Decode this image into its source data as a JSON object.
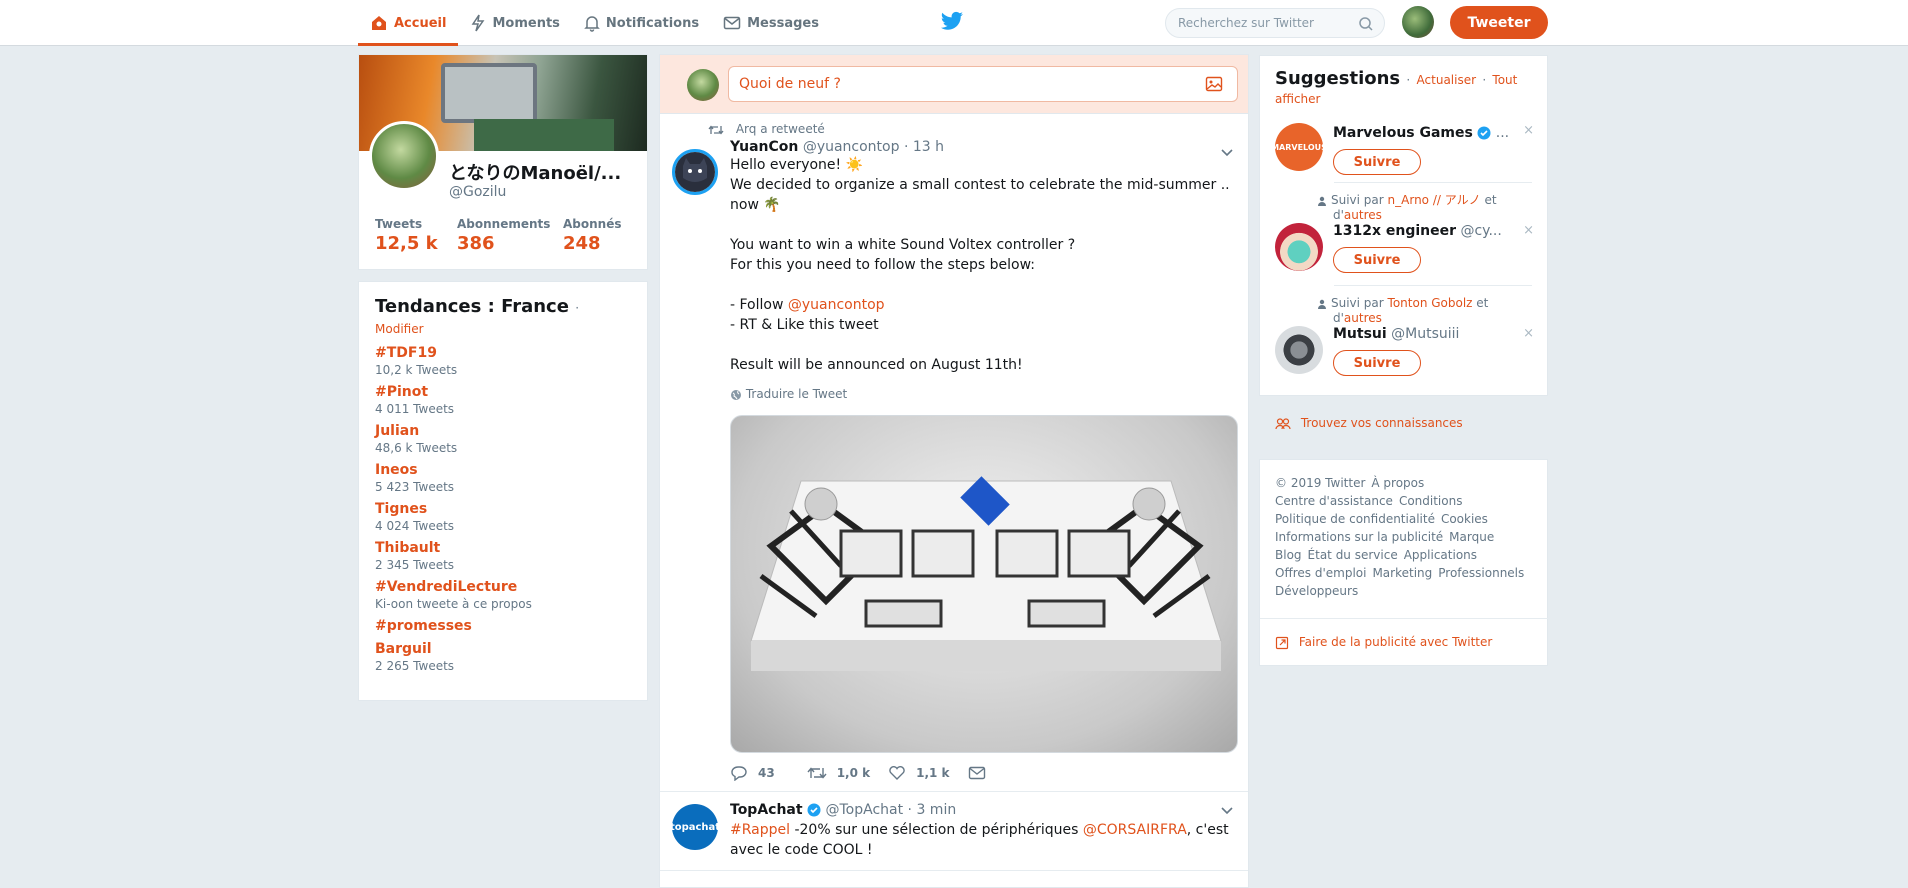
{
  "nav": {
    "home": "Accueil",
    "moments": "Moments",
    "notifications": "Notifications",
    "messages": "Messages",
    "search_placeholder": "Recherchez sur Twitter",
    "tweet_button": "Tweeter"
  },
  "profile": {
    "name": "となりのManoël/...",
    "handle": "@Gozilu",
    "stats": [
      {
        "label": "Tweets",
        "value": "12,5 k"
      },
      {
        "label": "Abonnements",
        "value": "386"
      },
      {
        "label": "Abonnés",
        "value": "248"
      }
    ]
  },
  "trends": {
    "title": "Tendances : France",
    "separator": "·",
    "change": "Modifier",
    "items": [
      {
        "name": "#TDF19",
        "meta": "10,2 k Tweets"
      },
      {
        "name": "#Pinot",
        "meta": "4 011 Tweets"
      },
      {
        "name": "Julian",
        "meta": "48,6 k Tweets"
      },
      {
        "name": "Ineos",
        "meta": "5 423 Tweets"
      },
      {
        "name": "Tignes",
        "meta": "4 024 Tweets"
      },
      {
        "name": "Thibault",
        "meta": "2 345 Tweets"
      },
      {
        "name": "#VendrediLecture",
        "meta": "Ki-oon tweete à ce propos"
      },
      {
        "name": "#promesses",
        "meta": ""
      },
      {
        "name": "Barguil",
        "meta": "2 265 Tweets"
      }
    ]
  },
  "compose": {
    "placeholder": "Quoi de neuf ?"
  },
  "timeline": {
    "tweet1": {
      "retweet_context": "Arq a retweeté",
      "display_name": "YuanCon",
      "handle": "@yuancontop",
      "time": "· 13 h",
      "text_lines": [
        "Hello everyone! ☀️",
        "We decided to organize a small contest to celebrate the mid-summer .. now 🌴",
        "",
        "You want to win a white Sound Voltex controller ?",
        "For this you need to follow the steps below:",
        "",
        "- Follow ",
        "- RT & Like this tweet",
        "",
        "Result will be announced on August 11th!"
      ],
      "mention": "@yuancontop",
      "translate": "Traduire le Tweet",
      "replies": "43",
      "retweets": "1,0 k",
      "likes": "1,1 k"
    },
    "tweet2": {
      "display_name": "TopAchat",
      "handle": "@TopAchat",
      "time": "· 3 min",
      "hashtag": "#Rappel",
      "text_a": " -20% sur une sélection de périphériques ",
      "mention": "@CORSAIRFRA",
      "text_b": ", c'est avec le code COOL !",
      "avatar_text": "topachat"
    }
  },
  "suggestions": {
    "title": "Suggestions",
    "separator": "·",
    "refresh": "Actualiser",
    "show_all": "Tout afficher",
    "follow_label": "Suivre",
    "items": [
      {
        "name": "Marvelous Games",
        "handle": "...",
        "context_prefix": "",
        "context_link": "",
        "context_mid": "",
        "context_link2": "",
        "avatar_text": "MARVELOUS"
      },
      {
        "name": "1312x engineer",
        "handle": "@cy...",
        "context_prefix": "Suivi par ",
        "context_link": "n_Arno // アルノ",
        "context_mid": " et d'",
        "context_link2": "autres"
      },
      {
        "name": "Mutsui",
        "handle": "@Mutsuiii",
        "context_prefix": "Suivi par ",
        "context_link": "Tonton Gobolz",
        "context_mid": " et d'",
        "context_link2": "autres"
      }
    ],
    "find_friends": "Trouvez vos connaissances"
  },
  "footer": {
    "links": [
      "© 2019 Twitter",
      "À propos",
      "Centre d'assistance",
      "Conditions",
      "Politique de confidentialité",
      "Cookies",
      "Informations sur la publicité",
      "Marque",
      "Blog",
      "État du service",
      "Applications",
      "Offres d'emploi",
      "Marketing",
      "Professionnels",
      "Développeurs"
    ],
    "ads": "Faire de la publicité avec Twitter"
  },
  "colors": {
    "accent": "#e0521c",
    "background": "#e6ecf0",
    "muted": "#657786"
  }
}
